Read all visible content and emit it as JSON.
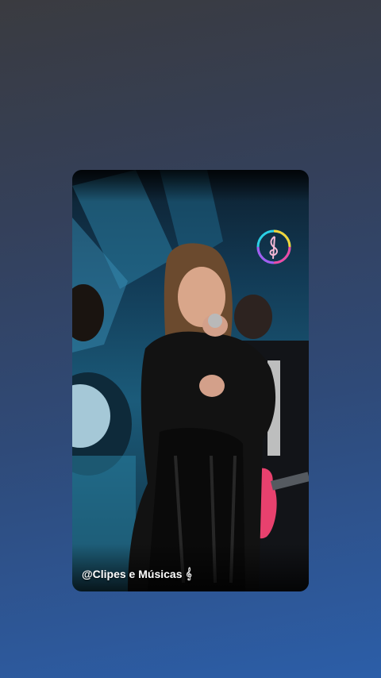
{
  "story": {
    "caption": "@Clipes e Músicas",
    "caption_icon": "music-staff-icon",
    "logo_icon": "treble-clef-logo-icon"
  },
  "colors": {
    "background_top": "#3a3b40",
    "background_bottom": "#2c5ea8",
    "stage_blue": "#1b5b7a",
    "guitar_pink": "#e8416e"
  }
}
